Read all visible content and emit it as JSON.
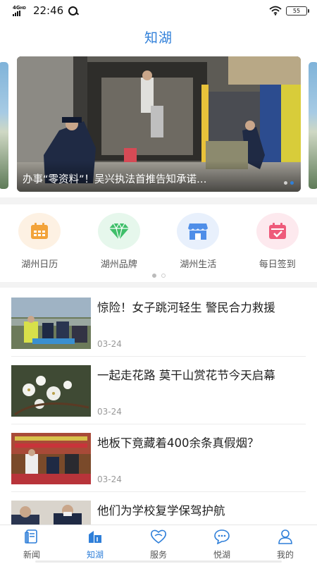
{
  "status_bar": {
    "network": "4G",
    "network_sub": "HD",
    "time": "22:46",
    "battery": "55"
  },
  "header": {
    "title": "知湖"
  },
  "carousel": {
    "caption": "办事“零资料”！吴兴执法首推告知承诺…",
    "slide_count": 2,
    "active_slide": 2
  },
  "quick_links": [
    {
      "label": "湖州日历",
      "icon": "calendar-icon",
      "bg": "#fdf1e3",
      "color": "#f2a33a"
    },
    {
      "label": "湖州品牌",
      "icon": "diamond-icon",
      "bg": "#e6f7ec",
      "color": "#3fbf6a"
    },
    {
      "label": "湖州生活",
      "icon": "shop-icon",
      "bg": "#e8f0fc",
      "color": "#4f8ee8"
    },
    {
      "label": "每日签到",
      "icon": "checkin-icon",
      "bg": "#fde9ee",
      "color": "#ee5a7a"
    }
  ],
  "quick_pages": {
    "count": 2,
    "active": 1
  },
  "news": [
    {
      "title": "惊险！女子跳河轻生  警民合力救援",
      "date": "03-24"
    },
    {
      "title": "一起走花路 莫干山赏花节今天启幕",
      "date": "03-24"
    },
    {
      "title": "地板下竟藏着400余条真假烟？",
      "date": "03-24"
    },
    {
      "title": "他们为学校复学保驾护航",
      "date": ""
    }
  ],
  "bottom_nav": [
    {
      "label": "新闻",
      "icon": "news-icon",
      "active": false
    },
    {
      "label": "知湖",
      "icon": "zhihu-icon",
      "active": true
    },
    {
      "label": "服务",
      "icon": "heart-icon",
      "active": false
    },
    {
      "label": "悦湖",
      "icon": "chat-icon",
      "active": false
    },
    {
      "label": "我的",
      "icon": "user-icon",
      "active": false
    }
  ],
  "colors": {
    "accent": "#2f7fd9",
    "separator": "#f3f3f3"
  }
}
